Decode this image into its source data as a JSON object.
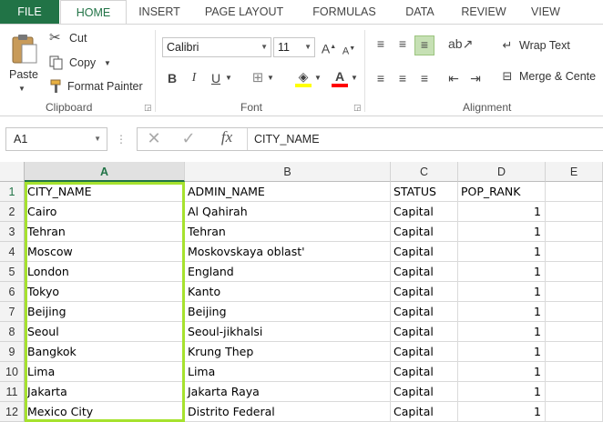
{
  "tabs": [
    "FILE",
    "HOME",
    "INSERT",
    "PAGE LAYOUT",
    "FORMULAS",
    "DATA",
    "REVIEW",
    "VIEW"
  ],
  "clipboard": {
    "paste": "Paste",
    "cut": "Cut",
    "copy": "Copy",
    "format_painter": "Format Painter",
    "label": "Clipboard"
  },
  "font": {
    "name": "Calibri",
    "size": "11",
    "label": "Font",
    "bold": "B",
    "italic": "I",
    "underline": "U",
    "grow": "A",
    "shrink": "A",
    "font_color": "A"
  },
  "alignment": {
    "wrap_text": "Wrap Text",
    "merge_center": "Merge & Cente",
    "label": "Alignment"
  },
  "formula_bar": {
    "name_box": "A1",
    "fx": "fx",
    "value": "CITY_NAME"
  },
  "columns": [
    "A",
    "B",
    "C",
    "D",
    "E"
  ],
  "selected_column": "A",
  "rows": [
    {
      "n": "1",
      "cells": [
        "CITY_NAME",
        "ADMIN_NAME",
        "STATUS",
        "POP_RANK"
      ]
    },
    {
      "n": "2",
      "cells": [
        "Cairo",
        "Al Qahirah",
        "Capital",
        "1"
      ]
    },
    {
      "n": "3",
      "cells": [
        "Tehran",
        "Tehran",
        "Capital",
        "1"
      ]
    },
    {
      "n": "4",
      "cells": [
        "Moscow",
        "Moskovskaya oblast'",
        "Capital",
        "1"
      ]
    },
    {
      "n": "5",
      "cells": [
        "London",
        "England",
        "Capital",
        "1"
      ]
    },
    {
      "n": "6",
      "cells": [
        "Tokyo",
        "Kanto",
        "Capital",
        "1"
      ]
    },
    {
      "n": "7",
      "cells": [
        "Beijing",
        "Beijing",
        "Capital",
        "1"
      ]
    },
    {
      "n": "8",
      "cells": [
        "Seoul",
        "Seoul-jikhalsi",
        "Capital",
        "1"
      ]
    },
    {
      "n": "9",
      "cells": [
        "Bangkok",
        "Krung Thep",
        "Capital",
        "1"
      ]
    },
    {
      "n": "10",
      "cells": [
        "Lima",
        "Lima",
        "Capital",
        "1"
      ]
    },
    {
      "n": "11",
      "cells": [
        "Jakarta",
        "Jakarta Raya",
        "Capital",
        "1"
      ]
    },
    {
      "n": "12",
      "cells": [
        "Mexico City",
        "Distrito Federal",
        "Capital",
        "1"
      ]
    }
  ],
  "colors": {
    "accent": "#217346",
    "selection_highlight": "#a6e22e"
  }
}
